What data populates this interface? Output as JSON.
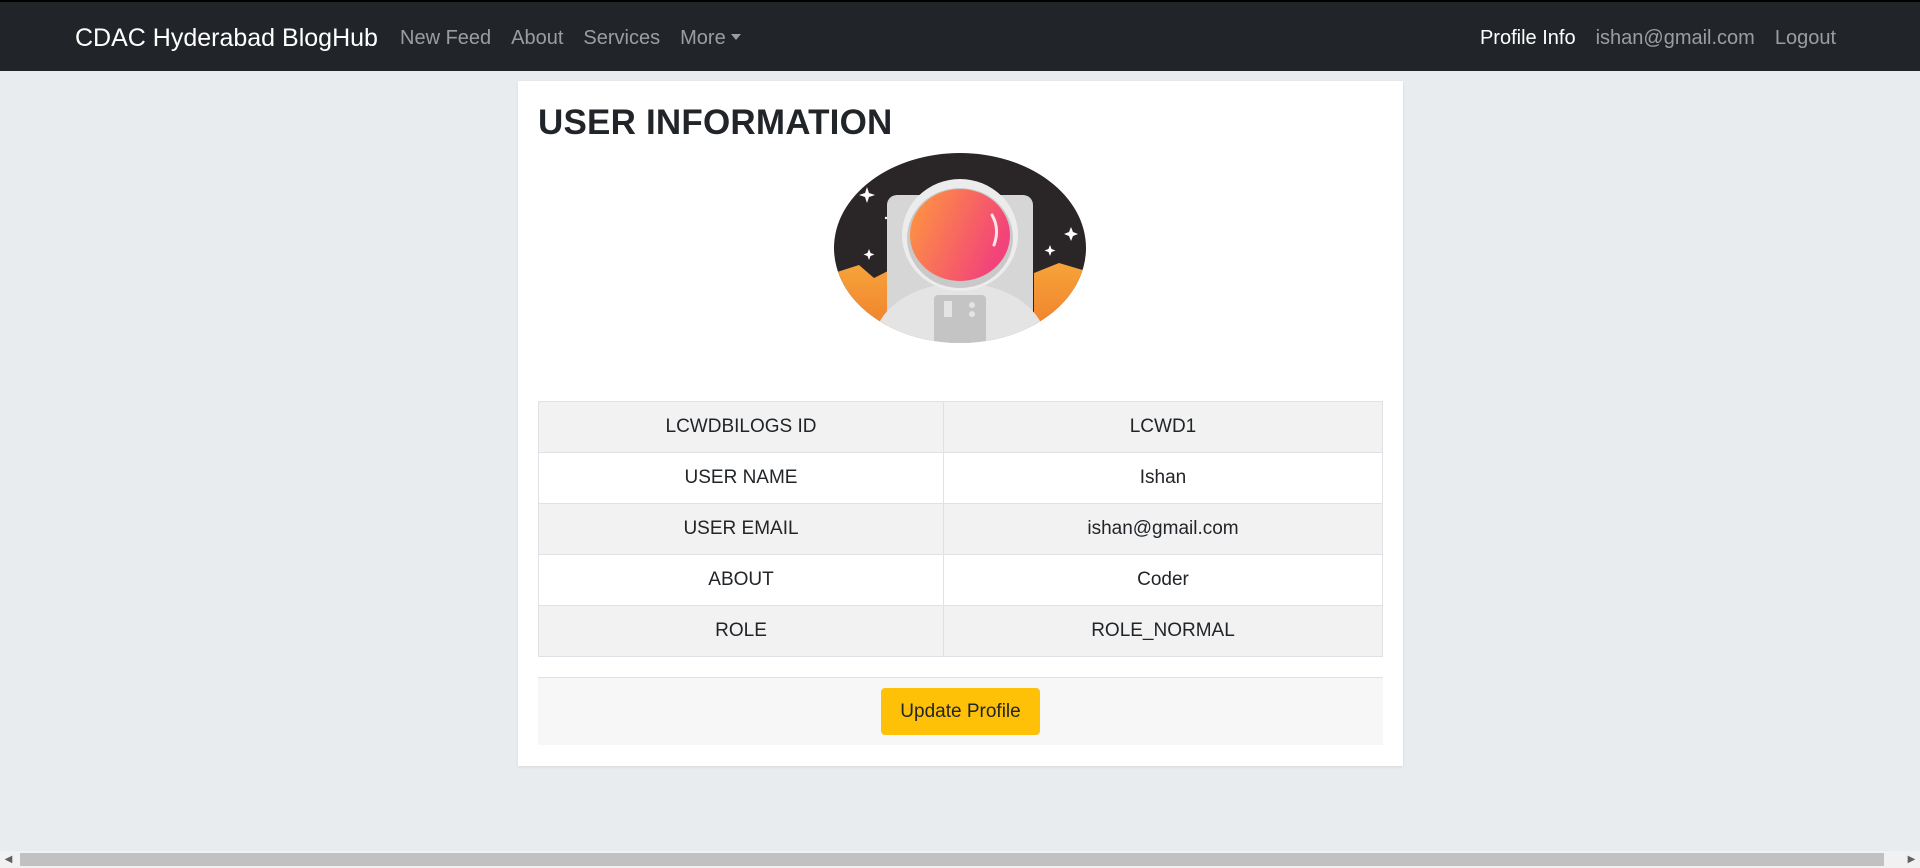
{
  "navbar": {
    "brand": "CDAC Hyderabad BlogHub",
    "left_links": [
      "New Feed",
      "About",
      "Services",
      "More"
    ],
    "right_links": {
      "profile": "Profile Info",
      "email": "ishan@gmail.com",
      "logout": "Logout"
    }
  },
  "card": {
    "title": "USER INFORMATION",
    "avatar_icon": "astronaut-avatar-icon",
    "rows": [
      {
        "label": "LCWDBILOGS ID",
        "value": "LCWD1"
      },
      {
        "label": "USER NAME",
        "value": "Ishan"
      },
      {
        "label": "USER EMAIL",
        "value": "ishan@gmail.com"
      },
      {
        "label": "ABOUT",
        "value": "Coder"
      },
      {
        "label": "ROLE",
        "value": "ROLE_NORMAL"
      }
    ],
    "update_button": "Update Profile"
  },
  "colors": {
    "navbar_bg": "#212529",
    "page_bg": "#e9ecef",
    "warning_button": "#ffc107"
  }
}
